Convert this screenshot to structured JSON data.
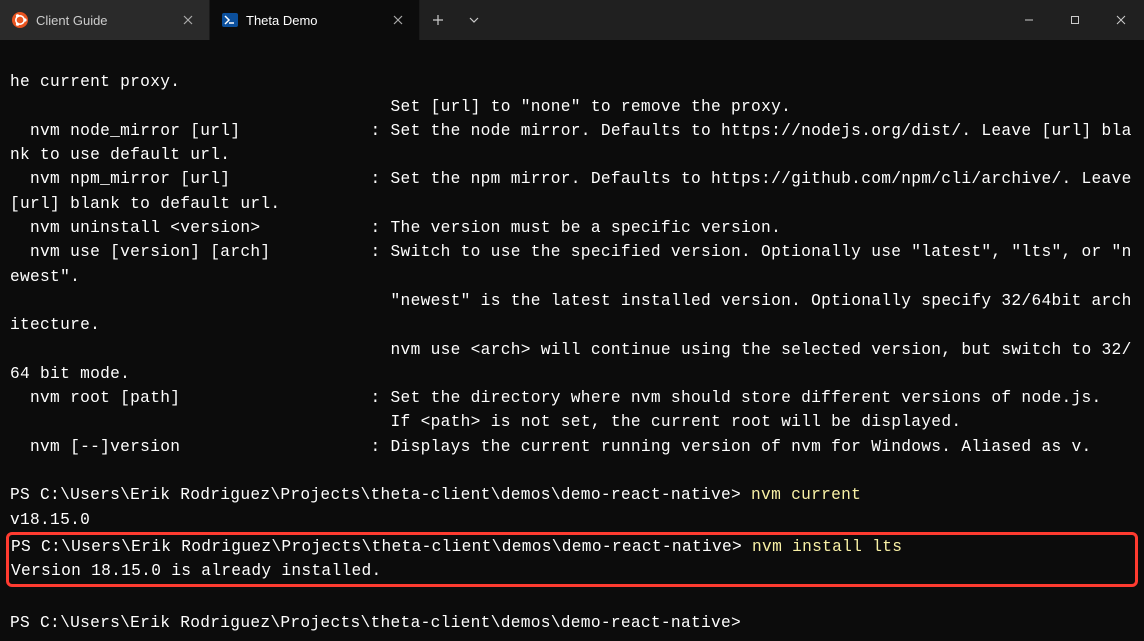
{
  "tabs": [
    {
      "label": "Client Guide",
      "icon": "ubuntu"
    },
    {
      "label": "Theta Demo",
      "icon": "powershell"
    }
  ],
  "path": "PS C:\\Users\\Erik Rodriguez\\Projects\\theta-client\\demos\\demo-react-native>",
  "lines": {
    "l0": "he current proxy.",
    "l1": "                                      Set [url] to \"none\" to remove the proxy.",
    "l2": "  nvm node_mirror [url]             : Set the node mirror. Defaults to https://nodejs.org/dist/. Leave [url] blank to use default url.",
    "l3": "  nvm npm_mirror [url]              : Set the npm mirror. Defaults to https://github.com/npm/cli/archive/. Leave [url] blank to default url.",
    "l4": "  nvm uninstall <version>           : The version must be a specific version.",
    "l5": "  nvm use [version] [arch]          : Switch to use the specified version. Optionally use \"latest\", \"lts\", or \"newest\".",
    "l6": "                                      \"newest\" is the latest installed version. Optionally specify 32/64bit architecture.",
    "l7": "                                      nvm use <arch> will continue using the selected version, but switch to 32/64 bit mode.",
    "l8": "  nvm root [path]                   : Set the directory where nvm should store different versions of node.js.",
    "l9": "                                      If <path> is not set, the current root will be displayed.",
    "l10": "  nvm [--]version                   : Displays the current running version of nvm for Windows. Aliased as v.",
    "blank": "",
    "cmd1": " nvm current",
    "out1": "v18.15.0",
    "cmd2": " nvm install lts",
    "out2": "Version 18.15.0 is already installed."
  }
}
